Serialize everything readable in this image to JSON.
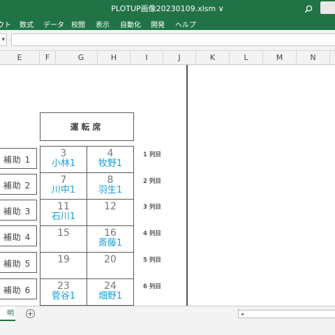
{
  "window": {
    "title": "PLOTUP画像20230109.xlsm ∨"
  },
  "ribbon": {
    "tabs": [
      "ウト",
      "数式",
      "データ",
      "校閲",
      "表示",
      "自動化",
      "開発",
      "ヘルプ"
    ]
  },
  "formula_bar": {
    "name_box_value": "▾",
    "content": ""
  },
  "columns": [
    "E",
    "F",
    "G",
    "H",
    "I",
    "J",
    "K",
    "L",
    "M",
    "N"
  ],
  "sheet": {
    "driver_label": "運転席",
    "aux_seats": [
      "補助 1",
      "補助 2",
      "補助 3",
      "補助 4",
      "補助 5",
      "補助 6"
    ],
    "row_labels": [
      "1 列目",
      "2 列目",
      "3 列目",
      "4 列目",
      "5 列目",
      "6 列目"
    ],
    "seats": [
      {
        "num": "3",
        "name": "小林1"
      },
      {
        "num": "4",
        "name": "牧野1"
      },
      {
        "num": "7",
        "name": "川中1"
      },
      {
        "num": "8",
        "name": "羽生1"
      },
      {
        "num": "11",
        "name": "石川1"
      },
      {
        "num": "12",
        "name": ""
      },
      {
        "num": "15",
        "name": ""
      },
      {
        "num": "16",
        "name": "斎藤1"
      },
      {
        "num": "19",
        "name": ""
      },
      {
        "num": "20",
        "name": ""
      },
      {
        "num": "23",
        "name": "菅谷1"
      },
      {
        "num": "24",
        "name": "畑野1"
      }
    ]
  },
  "sheet_tabs": {
    "active_tab": "明",
    "add_label": "+",
    "separator": "⋮",
    "scroll_left": "◂"
  },
  "colors": {
    "accent": "#217346",
    "name_text": "#1aa0d8"
  }
}
